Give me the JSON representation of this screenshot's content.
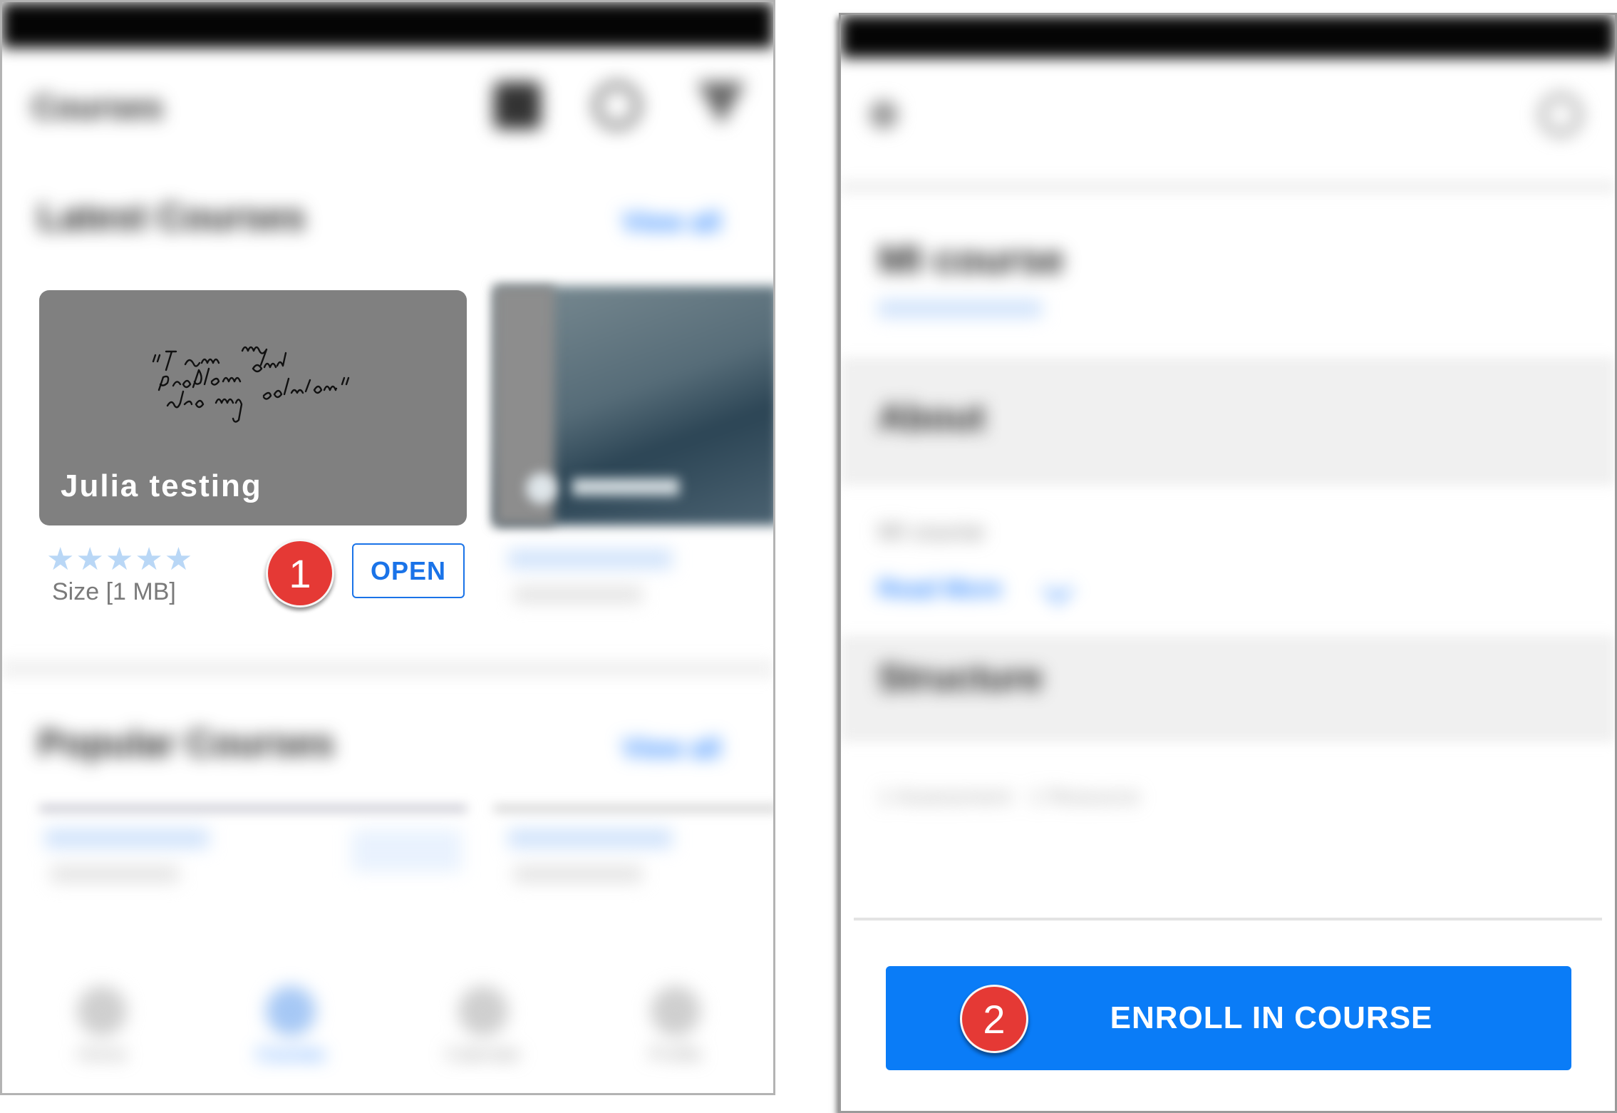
{
  "left_screen": {
    "app_title": "Courses",
    "sections": [
      {
        "title": "Latest Courses",
        "view_all": "View all"
      },
      {
        "title": "Popular Courses",
        "view_all": "View all"
      }
    ],
    "featured_card": {
      "thumbnail_quote": "\"I am my problem and also my solution.\"",
      "title": "Julia testing",
      "stars": "★★★★★",
      "size": "Size [1 MB]",
      "open_label": "OPEN"
    },
    "bottom_nav": [
      "Home",
      "Courses",
      "Calendar",
      "Profile"
    ]
  },
  "right_screen": {
    "course_title": "MI course",
    "about_heading": "About",
    "description": "MI course",
    "read_more": "Read More",
    "structure_heading": "Structure",
    "structure_summary": "1 Assessment · 1 Resource",
    "enroll_label": "ENROLL IN COURSE"
  },
  "annotations": {
    "step1": "1",
    "step2": "2"
  },
  "colors": {
    "accent_blue": "#0a7cf7",
    "badge_red": "#e53935"
  },
  "icons": [
    "grid-icon",
    "search-icon",
    "filter-icon",
    "back-arrow-icon",
    "share-icon",
    "play-icon",
    "home-icon",
    "courses-icon",
    "calendar-icon",
    "profile-icon",
    "chevron-down-icon"
  ]
}
